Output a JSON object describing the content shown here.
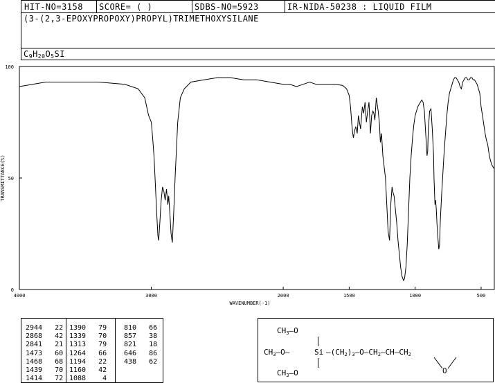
{
  "header": {
    "hit_no": "HIT-NO=3158",
    "score": "SCORE=  (   )",
    "sdbs_no": "SDBS-NO=5923",
    "ir_info": "IR-NIDA-50238 : LIQUID FILM"
  },
  "compound": {
    "name": "(3-(2,3-EPOXYPROPOXY)PROPYL)TRIMETHOXYSILANE",
    "formula_parts": [
      "C",
      "9",
      "H",
      "20",
      "O",
      "5",
      "SI"
    ]
  },
  "chart_data": {
    "type": "line",
    "xlabel": "WAVENUMBER(-1)",
    "ylabel": "TRANSMITTANCE(%)",
    "xlim": [
      4000,
      400
    ],
    "ylim": [
      0,
      100
    ],
    "x_ticks": [
      4000,
      3000,
      2000,
      1500,
      1000,
      500
    ],
    "y_ticks": [
      0,
      50,
      100
    ],
    "series": [
      {
        "x": [
          4000,
          3900,
          3800,
          3700,
          3600,
          3500,
          3400,
          3300,
          3200,
          3100,
          3050,
          3020,
          3000,
          2990,
          2980,
          2970,
          2960,
          2950,
          2944,
          2935,
          2925,
          2915,
          2905,
          2895,
          2885,
          2875,
          2868,
          2860,
          2850,
          2841,
          2830,
          2820,
          2800,
          2780,
          2750,
          2700,
          2600,
          2500,
          2400,
          2300,
          2200,
          2100,
          2000,
          1950,
          1900,
          1850,
          1800,
          1750,
          1700,
          1650,
          1600,
          1550,
          1520,
          1500,
          1490,
          1480,
          1473,
          1468,
          1460,
          1450,
          1439,
          1430,
          1414,
          1400,
          1390,
          1380,
          1370,
          1360,
          1350,
          1339,
          1330,
          1320,
          1313,
          1305,
          1295,
          1280,
          1270,
          1264,
          1255,
          1245,
          1235,
          1225,
          1215,
          1205,
          1194,
          1185,
          1175,
          1170,
          1160,
          1150,
          1140,
          1130,
          1120,
          1110,
          1100,
          1088,
          1080,
          1070,
          1060,
          1050,
          1040,
          1030,
          1020,
          1010,
          1000,
          990,
          980,
          970,
          960,
          950,
          940,
          930,
          920,
          910,
          905,
          900,
          890,
          880,
          870,
          860,
          857,
          850,
          845,
          840,
          835,
          830,
          821,
          815,
          810,
          800,
          790,
          780,
          770,
          760,
          750,
          740,
          730,
          720,
          710,
          700,
          690,
          680,
          670,
          660,
          650,
          646,
          640,
          630,
          620,
          610,
          600,
          590,
          580,
          570,
          560,
          550,
          540,
          530,
          520,
          510,
          500,
          490,
          480,
          470,
          460,
          450,
          438,
          430,
          420,
          410,
          400
        ],
        "y": [
          91,
          92,
          93,
          93,
          93,
          93,
          93,
          92.5,
          92,
          90,
          86,
          78,
          75,
          68,
          60,
          48,
          35,
          24,
          22,
          30,
          40,
          46,
          44,
          40,
          45,
          38,
          42,
          35,
          25,
          21,
          35,
          50,
          75,
          86,
          90,
          93,
          94,
          95,
          95,
          94,
          94,
          93,
          92,
          92,
          91,
          92,
          93,
          92,
          92,
          92,
          92,
          91.5,
          90,
          87,
          82,
          74,
          70,
          68,
          71,
          73,
          70,
          78,
          72,
          82,
          79,
          84,
          75,
          80,
          84,
          70,
          78,
          80,
          79,
          76,
          86,
          80,
          74,
          66,
          70,
          60,
          55,
          50,
          38,
          26,
          22,
          38,
          46,
          44,
          42,
          36,
          30,
          22,
          16,
          10,
          6,
          4,
          5,
          10,
          20,
          35,
          50,
          60,
          68,
          74,
          78,
          80,
          82,
          83,
          84,
          85,
          84,
          80,
          70,
          60,
          62,
          72,
          80,
          81,
          72,
          60,
          50,
          38,
          40,
          36,
          30,
          25,
          18,
          20,
          30,
          42,
          52,
          62,
          70,
          78,
          84,
          88,
          90,
          92,
          94,
          95,
          95,
          94,
          93,
          91,
          90,
          91,
          93,
          94,
          95,
          95,
          94,
          94,
          95,
          95,
          94,
          94,
          93,
          92,
          90,
          88,
          82,
          78,
          74,
          70,
          67,
          65,
          60,
          58,
          56,
          55,
          54
        ]
      }
    ],
    "grid": false,
    "legend": "none"
  },
  "peak_table": {
    "columns": [
      {
        "wavenumbers": [
          "2944",
          "2868",
          "2841",
          "1473",
          "1468",
          "1439",
          "1414"
        ],
        "intensities": [
          "22",
          "42",
          "21",
          "60",
          "68",
          "70",
          "72"
        ]
      },
      {
        "wavenumbers": [
          "1390",
          "1339",
          "1313",
          "1264",
          "1194",
          "1160",
          "1088"
        ],
        "intensities": [
          "79",
          "70",
          "79",
          "66",
          "22",
          "42",
          "4"
        ]
      },
      {
        "wavenumbers": [
          "810",
          "857",
          "821",
          "646",
          "438"
        ],
        "intensities": [
          "66",
          "38",
          "18",
          "86",
          "62"
        ]
      }
    ]
  },
  "structure": {
    "top_methoxy": "CH3—O",
    "left_methoxy": "CH3—O—",
    "silicon": "Si",
    "chain": "—(CH2)3—O—CH2—CH—CH2",
    "epoxide_oxygen": "O",
    "bottom_methoxy": "CH3—O"
  }
}
